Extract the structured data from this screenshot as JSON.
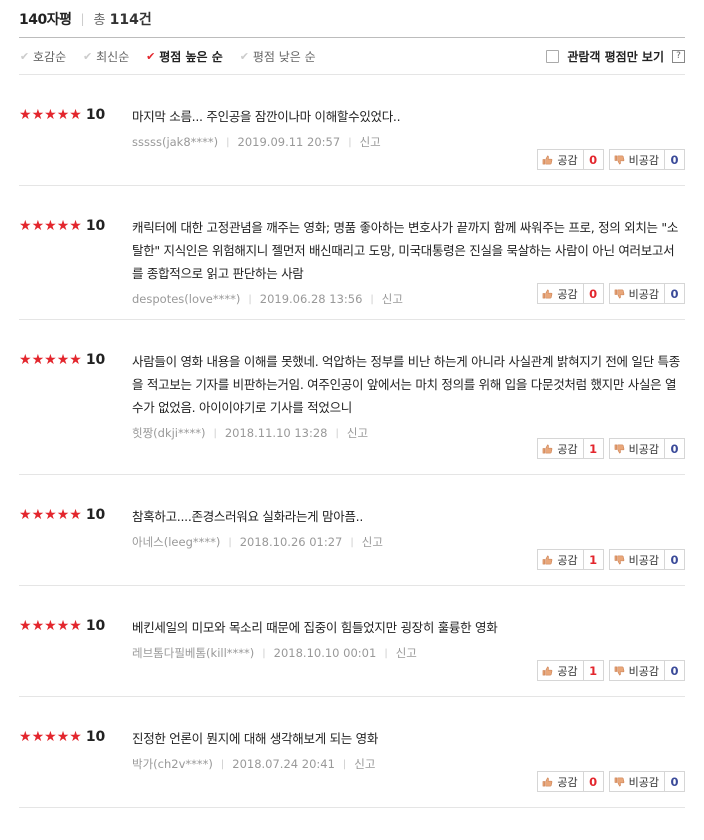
{
  "header": {
    "title": "140자평",
    "total_label": "총",
    "total_count": "114",
    "total_unit": "건"
  },
  "sort": {
    "options": [
      {
        "label": "호감순",
        "active": false
      },
      {
        "label": "최신순",
        "active": false
      },
      {
        "label": "평점 높은 순",
        "active": true
      },
      {
        "label": "평점 낮은 순",
        "active": false
      }
    ],
    "audience_label": "관람객 평점만 보기",
    "help_label": "?"
  },
  "labels": {
    "report": "신고",
    "like": "공감",
    "dislike": "비공감"
  },
  "colors": {
    "star": "#e3262d",
    "like_count": "#e3262d",
    "dislike_count": "#3a4a99"
  },
  "reviews": [
    {
      "stars": 5,
      "score": "10",
      "text": "마지막 소름... 주인공을 잠깐이나마 이해할수있었다..",
      "user": "sssss(jak8****)",
      "date": "2019.09.11 20:57",
      "likes": "0",
      "dislikes": "0"
    },
    {
      "stars": 5,
      "score": "10",
      "text": "캐릭터에 대한 고정관념을 깨주는 영화; 명품 좋아하는 변호사가 끝까지 함께 싸워주는 프로, 정의 외치는 \"소탈한\" 지식인은 위험해지니 젤먼저 배신때리고 도망, 미국대통령은 진실을 묵살하는 사람이 아닌 여러보고서를 종합적으로 읽고 판단하는 사람",
      "user": "despotes(love****)",
      "date": "2019.06.28 13:56",
      "likes": "0",
      "dislikes": "0"
    },
    {
      "stars": 5,
      "score": "10",
      "text": "사람들이 영화 내용을 이해를 못했네. 억압하는 정부를 비난 하는게 아니라 사실관계 밝혀지기 전에 일단 특종을 적고보는 기자를 비판하는거임. 여주인공이 앞에서는 마치 정의를 위해 입을 다문것처럼 했지만 사실은 열수가 없었음. 아이이야기로 기사를 적었으니",
      "user": "힛짱(dkji****)",
      "date": "2018.11.10 13:28",
      "likes": "1",
      "dislikes": "0"
    },
    {
      "stars": 5,
      "score": "10",
      "text": "참혹하고....존경스러워요 실화라는게 맘아픔..",
      "user": "아네스(leeg****)",
      "date": "2018.10.26 01:27",
      "likes": "1",
      "dislikes": "0"
    },
    {
      "stars": 5,
      "score": "10",
      "text": "베킨세일의 미모와 목소리 때문에 집중이 힘들었지만 굉장히 훌륭한 영화",
      "user": "레브톰다필베톰(kill****)",
      "date": "2018.10.10 00:01",
      "likes": "1",
      "dislikes": "0"
    },
    {
      "stars": 5,
      "score": "10",
      "text": "진정한 언론이 뭔지에 대해 생각해보게 되는 영화",
      "user": "박가(ch2v****)",
      "date": "2018.07.24 20:41",
      "likes": "0",
      "dislikes": "0"
    }
  ]
}
